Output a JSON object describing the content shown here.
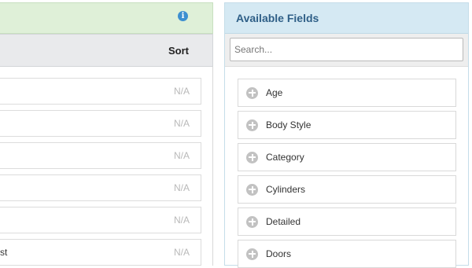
{
  "left_panel": {
    "sort_label": "Sort",
    "info_glyph": "i",
    "rows": [
      {
        "text": "",
        "value": "N/A"
      },
      {
        "text": "",
        "value": "N/A"
      },
      {
        "text": "",
        "value": "N/A"
      },
      {
        "text": "",
        "value": "N/A"
      },
      {
        "text": "",
        "value": "N/A"
      },
      {
        "text": "st",
        "value": "N/A"
      }
    ]
  },
  "available_fields": {
    "title": "Available Fields",
    "search_placeholder": "Search...",
    "items": [
      {
        "label": "Age",
        "icon": "plus-circle-icon"
      },
      {
        "label": "Body Style",
        "icon": "plus-circle-icon"
      },
      {
        "label": "Category",
        "icon": "plus-circle-icon"
      },
      {
        "label": "Cylinders",
        "icon": "plus-circle-icon"
      },
      {
        "label": "Detailed",
        "icon": "plus-circle-icon"
      },
      {
        "label": "Doors",
        "icon": "plus-circle-icon"
      }
    ]
  },
  "colors": {
    "green_header": "#dff0d8",
    "blue_header": "#d5e9f3",
    "title_text": "#2f5f87",
    "info_icon": "#3d8fd0",
    "na_text": "#b9b9b9",
    "plus_icon": "#c2c2c2"
  }
}
